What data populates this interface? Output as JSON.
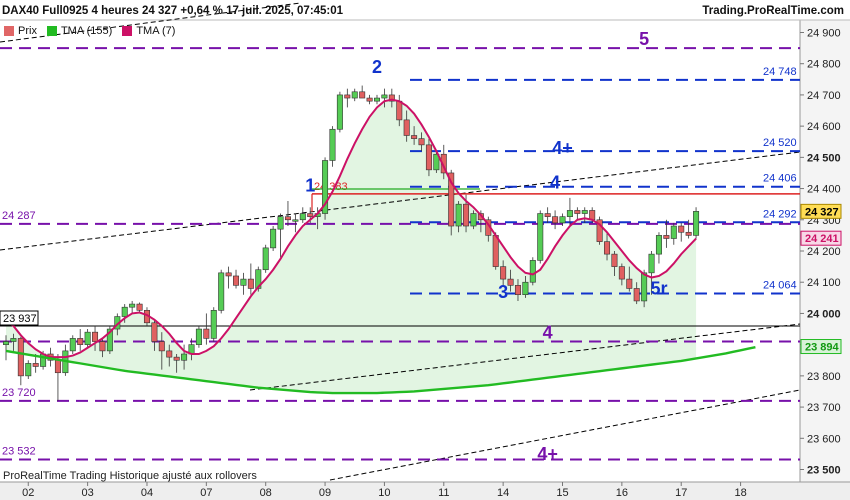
{
  "header": {
    "title": "DAX40 Full0925 4 heures 24 327 +0,64 % 17 juil. 2025, 07:45:01",
    "brand": "Trading.ProRealTime.com"
  },
  "legend": [
    {
      "label": "Prix",
      "color": "#e06666"
    },
    {
      "label": "TMA (155)",
      "color": "#22bb22"
    },
    {
      "label": "TMA (7)",
      "color": "#cc1166"
    }
  ],
  "watermark": "ProRealTime Trading  Historique ajusté aux rollovers",
  "chart_data": {
    "type": "candlestick",
    "ylim": [
      23460,
      24940
    ],
    "y_ticks": [
      {
        "value": 24900,
        "label": "24 900",
        "bold": false
      },
      {
        "value": 24800,
        "label": "24 800",
        "bold": false
      },
      {
        "value": 24700,
        "label": "24 700",
        "bold": false
      },
      {
        "value": 24600,
        "label": "24 600",
        "bold": false
      },
      {
        "value": 24500,
        "label": "24 500",
        "bold": true
      },
      {
        "value": 24400,
        "label": "24 400",
        "bold": false
      },
      {
        "value": 24300,
        "label": "24 300",
        "bold": false
      },
      {
        "value": 24200,
        "label": "24 200",
        "bold": false
      },
      {
        "value": 24100,
        "label": "24 100",
        "bold": false
      },
      {
        "value": 24000,
        "label": "24 000",
        "bold": true
      },
      {
        "value": 23900,
        "label": "23 900",
        "bold": false
      },
      {
        "value": 23800,
        "label": "23 800",
        "bold": false
      },
      {
        "value": 23700,
        "label": "23 700",
        "bold": false
      },
      {
        "value": 23600,
        "label": "23 600",
        "bold": false
      },
      {
        "value": 23500,
        "label": "23 500",
        "bold": true
      }
    ],
    "x_ticks": [
      {
        "index": 3,
        "label": "02"
      },
      {
        "index": 11,
        "label": "03"
      },
      {
        "index": 19,
        "label": "04"
      },
      {
        "index": 27,
        "label": "07"
      },
      {
        "index": 35,
        "label": "08"
      },
      {
        "index": 43,
        "label": "09"
      },
      {
        "index": 51,
        "label": "10"
      },
      {
        "index": 59,
        "label": "11"
      },
      {
        "index": 67,
        "label": "14"
      },
      {
        "index": 75,
        "label": "15"
      },
      {
        "index": 83,
        "label": "16"
      },
      {
        "index": 91,
        "label": "17"
      },
      {
        "index": 99,
        "label": "18"
      }
    ],
    "candles": [
      [
        23900,
        23930,
        23850,
        23910
      ],
      [
        23910,
        23935,
        23880,
        23920
      ],
      [
        23920,
        23925,
        23770,
        23800
      ],
      [
        23800,
        23850,
        23790,
        23840
      ],
      [
        23840,
        23870,
        23810,
        23830
      ],
      [
        23830,
        23880,
        23820,
        23870
      ],
      [
        23870,
        23890,
        23830,
        23850
      ],
      [
        23850,
        23870,
        23720,
        23810
      ],
      [
        23810,
        23900,
        23800,
        23880
      ],
      [
        23880,
        23930,
        23870,
        23920
      ],
      [
        23920,
        23950,
        23880,
        23900
      ],
      [
        23900,
        23950,
        23890,
        23940
      ],
      [
        23940,
        23960,
        23880,
        23910
      ],
      [
        23910,
        23920,
        23860,
        23880
      ],
      [
        23880,
        23960,
        23870,
        23950
      ],
      [
        23950,
        24000,
        23930,
        23990
      ],
      [
        23990,
        24030,
        23970,
        24020
      ],
      [
        24020,
        24040,
        24000,
        24030
      ],
      [
        24030,
        24035,
        24000,
        24010
      ],
      [
        24010,
        24020,
        23960,
        23970
      ],
      [
        23970,
        23980,
        23880,
        23910
      ],
      [
        23910,
        23940,
        23820,
        23880
      ],
      [
        23880,
        23900,
        23830,
        23860
      ],
      [
        23860,
        23870,
        23810,
        23850
      ],
      [
        23850,
        23900,
        23820,
        23870
      ],
      [
        23870,
        23920,
        23850,
        23900
      ],
      [
        23900,
        23960,
        23890,
        23950
      ],
      [
        23950,
        24000,
        23900,
        23920
      ],
      [
        23920,
        24020,
        23910,
        24010
      ],
      [
        24010,
        24140,
        24000,
        24130
      ],
      [
        24130,
        24150,
        24080,
        24120
      ],
      [
        24120,
        24140,
        24080,
        24090
      ],
      [
        24090,
        24130,
        24060,
        24110
      ],
      [
        24110,
        24160,
        24060,
        24080
      ],
      [
        24080,
        24150,
        24070,
        24140
      ],
      [
        24140,
        24220,
        24130,
        24210
      ],
      [
        24210,
        24280,
        24200,
        24270
      ],
      [
        24270,
        24320,
        24180,
        24310
      ],
      [
        24310,
        24360,
        24280,
        24300
      ],
      [
        24300,
        24320,
        24260,
        24300
      ],
      [
        24300,
        24340,
        24290,
        24320
      ],
      [
        24320,
        24340,
        24290,
        24310
      ],
      [
        24310,
        24340,
        24270,
        24320
      ],
      [
        24320,
        24500,
        24300,
        24490
      ],
      [
        24490,
        24600,
        24470,
        24590
      ],
      [
        24590,
        24710,
        24580,
        24700
      ],
      [
        24700,
        24720,
        24660,
        24690
      ],
      [
        24690,
        24720,
        24680,
        24710
      ],
      [
        24710,
        24730,
        24690,
        24690
      ],
      [
        24690,
        24700,
        24670,
        24680
      ],
      [
        24680,
        24700,
        24670,
        24690
      ],
      [
        24690,
        24720,
        24660,
        24700
      ],
      [
        24700,
        24720,
        24660,
        24680
      ],
      [
        24680,
        24700,
        24600,
        24620
      ],
      [
        24620,
        24650,
        24550,
        24570
      ],
      [
        24570,
        24600,
        24540,
        24560
      ],
      [
        24560,
        24580,
        24520,
        24540
      ],
      [
        24540,
        24560,
        24440,
        24460
      ],
      [
        24460,
        24520,
        24450,
        24510
      ],
      [
        24510,
        24540,
        24430,
        24450
      ],
      [
        24450,
        24460,
        24250,
        24280
      ],
      [
        24280,
        24360,
        24260,
        24350
      ],
      [
        24350,
        24380,
        24260,
        24280
      ],
      [
        24280,
        24330,
        24270,
        24320
      ],
      [
        24320,
        24330,
        24260,
        24300
      ],
      [
        24300,
        24310,
        24230,
        24250
      ],
      [
        24250,
        24260,
        24140,
        24150
      ],
      [
        24150,
        24170,
        24090,
        24110
      ],
      [
        24110,
        24140,
        24070,
        24090
      ],
      [
        24090,
        24110,
        24040,
        24060
      ],
      [
        24060,
        24120,
        24050,
        24100
      ],
      [
        24100,
        24180,
        24090,
        24170
      ],
      [
        24170,
        24330,
        24160,
        24320
      ],
      [
        24320,
        24340,
        24290,
        24310
      ],
      [
        24310,
        24330,
        24270,
        24290
      ],
      [
        24290,
        24320,
        24280,
        24310
      ],
      [
        24310,
        24370,
        24280,
        24330
      ],
      [
        24330,
        24340,
        24300,
        24320
      ],
      [
        24320,
        24340,
        24290,
        24330
      ],
      [
        24330,
        24340,
        24290,
        24300
      ],
      [
        24300,
        24310,
        24220,
        24230
      ],
      [
        24230,
        24260,
        24170,
        24190
      ],
      [
        24190,
        24200,
        24120,
        24150
      ],
      [
        24150,
        24160,
        24090,
        24110
      ],
      [
        24110,
        24150,
        24070,
        24080
      ],
      [
        24080,
        24100,
        24030,
        24040
      ],
      [
        24040,
        24140,
        24020,
        24130
      ],
      [
        24130,
        24200,
        24060,
        24190
      ],
      [
        24190,
        24260,
        24160,
        24250
      ],
      [
        24250,
        24300,
        24210,
        24240
      ],
      [
        24240,
        24290,
        24220,
        24280
      ],
      [
        24280,
        24290,
        24230,
        24260
      ],
      [
        24260,
        24300,
        24240,
        24250
      ],
      [
        24250,
        24340,
        24240,
        24327
      ]
    ],
    "series": [
      {
        "name": "TMA (7)",
        "color": "#cc1166",
        "values": [
          23975,
          23960,
          23930,
          23905,
          23885,
          23870,
          23860,
          23860,
          23860,
          23865,
          23875,
          23890,
          23905,
          23920,
          23940,
          23965,
          23985,
          24000,
          24003,
          23995,
          23980,
          23960,
          23935,
          23905,
          23880,
          23870,
          23870,
          23880,
          23895,
          23920,
          23950,
          23985,
          24020,
          24055,
          24085,
          24110,
          24140,
          24175,
          24215,
          24250,
          24280,
          24300,
          24320,
          24350,
          24390,
          24440,
          24495,
          24545,
          24590,
          24630,
          24660,
          24680,
          24685,
          24680,
          24665,
          24640,
          24605,
          24565,
          24520,
          24470,
          24420,
          24385,
          24360,
          24340,
          24315,
          24285,
          24250,
          24215,
          24180,
          24150,
          24130,
          24125,
          24140,
          24175,
          24215,
          24250,
          24280,
          24300,
          24305,
          24300,
          24285,
          24260,
          24230,
          24200,
          24170,
          24145,
          24125,
          24115,
          24120,
          24135,
          24160,
          24190,
          24215,
          24240
        ]
      },
      {
        "name": "TMA (155)",
        "color": "#22bb22",
        "values": [
          23880,
          23876,
          23872,
          23868,
          23864,
          23860,
          23856,
          23852,
          23848,
          23844,
          23840,
          23836,
          23832,
          23828,
          23824,
          23820,
          23816,
          23813,
          23810,
          23807,
          23804,
          23801,
          23798,
          23795,
          23792,
          23789,
          23786,
          23783,
          23780,
          23777,
          23774,
          23771,
          23768,
          23765,
          23762,
          23760,
          23758,
          23756,
          23754,
          23752,
          23750,
          23748,
          23747,
          23746,
          23745,
          23745,
          23745,
          23745,
          23745,
          23745,
          23745,
          23746,
          23747,
          23748,
          23749,
          23750,
          23752,
          23754,
          23756,
          23758,
          23760,
          23762,
          23764,
          23766,
          23768,
          23770,
          23773,
          23776,
          23779,
          23782,
          23785,
          23788,
          23791,
          23794,
          23797,
          23800,
          23803,
          23806,
          23809,
          23812,
          23815,
          23818,
          23821,
          23824,
          23827,
          23830,
          23833,
          23836,
          23839,
          23842,
          23845,
          23848,
          23852,
          23856,
          23860,
          23864,
          23868,
          23872,
          23877,
          23882,
          23887,
          23892
        ]
      }
    ],
    "support_resistance": [
      {
        "value": 24850,
        "label": "",
        "marker": "5",
        "color": "#7711aa",
        "style": "dash"
      },
      {
        "value": 24748,
        "label": "24 748",
        "marker": "2",
        "color": "#1133cc",
        "style": "dash"
      },
      {
        "value": 24520,
        "label": "24 520",
        "marker": "4+",
        "color": "#1133cc",
        "style": "dash"
      },
      {
        "value": 24406,
        "label": "24 406",
        "marker": "4",
        "color": "#1133cc",
        "style": "dash"
      },
      {
        "value": 24292,
        "label": "24 292",
        "marker": "",
        "color": "#1133cc",
        "style": "dash"
      },
      {
        "value": 24064,
        "label": "24 064",
        "marker": "5r",
        "color": "#1133cc",
        "style": "dash"
      },
      {
        "value": 24287,
        "label": "24 287",
        "marker": "",
        "color": "#7711aa",
        "style": "dash-left"
      },
      {
        "value": 23910,
        "label": "",
        "marker": "4",
        "color": "#7711aa",
        "style": "dash"
      },
      {
        "value": 23720,
        "label": "23 720",
        "marker": "",
        "color": "#7711aa",
        "style": "dash"
      },
      {
        "value": 23532,
        "label": "23 532",
        "marker": "4+",
        "color": "#7711aa",
        "style": "dash"
      }
    ],
    "price_label": "24 327",
    "price_value": 24327,
    "tma7_label": "24 241",
    "tma7_value": 24241,
    "tma155_label": "23 894",
    "tma155_value": 23894,
    "left_label_23937": "23 937",
    "red_line": {
      "value": 24383,
      "label": "24 383"
    },
    "wave_labels": [
      {
        "text": "1",
        "index": 41,
        "value": 24390,
        "color": "#1133cc"
      },
      {
        "text": "2",
        "index": 50,
        "value": 24770,
        "color": "#1133cc"
      },
      {
        "text": "3",
        "index": 67,
        "value": 24050,
        "color": "#1133cc"
      },
      {
        "text": "4",
        "index": 74,
        "value": 24400,
        "color": "#1133cc"
      },
      {
        "text": "4+",
        "index": 75,
        "value": 24510,
        "color": "#1133cc"
      },
      {
        "text": "5",
        "index": 86,
        "value": 24860,
        "color": "#7711aa"
      },
      {
        "text": "4",
        "index": 73,
        "value": 23920,
        "color": "#7711aa"
      },
      {
        "text": "4+",
        "index": 73,
        "value": 23530,
        "color": "#7711aa"
      },
      {
        "text": "5r",
        "index": 88,
        "value": 24060,
        "color": "#1133cc"
      }
    ]
  }
}
